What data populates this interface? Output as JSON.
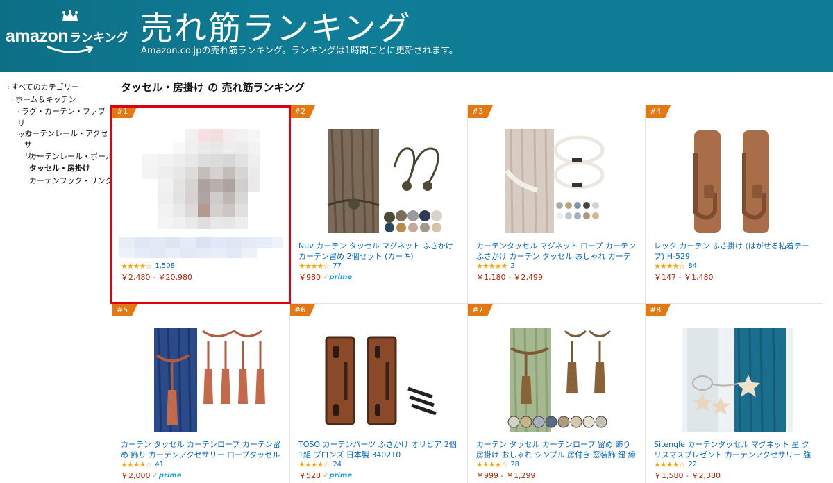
{
  "header": {
    "logo_word": "amazon",
    "logo_sub": "ランキング",
    "title": "売れ筋ランキング",
    "subtitle": "Amazon.co.jpの売れ筋ランキング。ランキングは1時間ごとに更新されます。"
  },
  "sidebar": {
    "items": [
      {
        "label": "すべてのカテゴリー"
      },
      {
        "label": "ホーム＆キッチン"
      },
      {
        "label": "ラグ・カーテン・ファブリ",
        "label2": "ック"
      },
      {
        "label": "カーテンレール・アクセサ",
        "label2": "リー"
      },
      {
        "label": "カーテンレール・ポール"
      },
      {
        "label": "タッセル・房掛け"
      },
      {
        "label": "カーテンフック・リング"
      }
    ]
  },
  "main": {
    "title": "タッセル・房掛け の 売れ筋ランキング"
  },
  "products": [
    {
      "rank": "#1",
      "title": "",
      "stars": "★★★★☆",
      "reviews": "1,508",
      "price": "￥2,480 - ￥20,980",
      "prime": ""
    },
    {
      "rank": "#2",
      "title": "Nuv カーテン タッセル マグネット ふさかけ カーテン留め 2個セット (カーキ)",
      "stars": "★★★★☆",
      "reviews": "77",
      "price": "￥980",
      "prime": "prime"
    },
    {
      "rank": "#3",
      "title": "カーテンタッセル マグネット ロープ カーテン ふさかけ カーテン タッセル おしゃれ カーテンホ…",
      "stars": "★★★★★",
      "reviews": "2",
      "price": "￥1,180 - ￥2,499",
      "prime": ""
    },
    {
      "rank": "#4",
      "title": "レック カーテン ふさ掛け (はがせる粘着テープ) H-529",
      "stars": "★★★★☆",
      "reviews": "84",
      "price": "￥147 - ￥1,480",
      "prime": ""
    },
    {
      "rank": "#5",
      "title": "カーテン タッセル カーテンロープ カーテン留め 飾り カーテンアクセサリー ロープタッセル 紐…",
      "stars": "★★★★☆",
      "reviews": "41",
      "price": "￥2,000",
      "prime": "prime"
    },
    {
      "rank": "#6",
      "title": "TOSO カーテンパーツ ふさかけ オリビア 2個1組 ブロンズ 日本製 340210",
      "stars": "★★★★☆",
      "reviews": "24",
      "price": "￥528",
      "prime": "prime"
    },
    {
      "rank": "#7",
      "title": "カーテン タッセル カーテンロープ 留め 飾り 房掛け おしゃれ シンプル 房付き 窓装飾 紐 締め 高…",
      "stars": "★★★★☆",
      "reviews": "28",
      "price": "￥999 - ￥1,299",
      "prime": ""
    },
    {
      "rank": "#8",
      "title": "Sitengle カーテンタッセル マグネット 星 クリスマスプレゼント カーテンアクセサリー 強力磁石…",
      "stars": "★★★★☆",
      "reviews": "22",
      "price": "￥1,580 - ￥2,380",
      "prime": ""
    }
  ],
  "colors": {
    "header_bg": "#0f7d97",
    "rank_badge": "#e47911",
    "link": "#0066c0",
    "price": "#b12704",
    "highlight": "#e1000f"
  }
}
